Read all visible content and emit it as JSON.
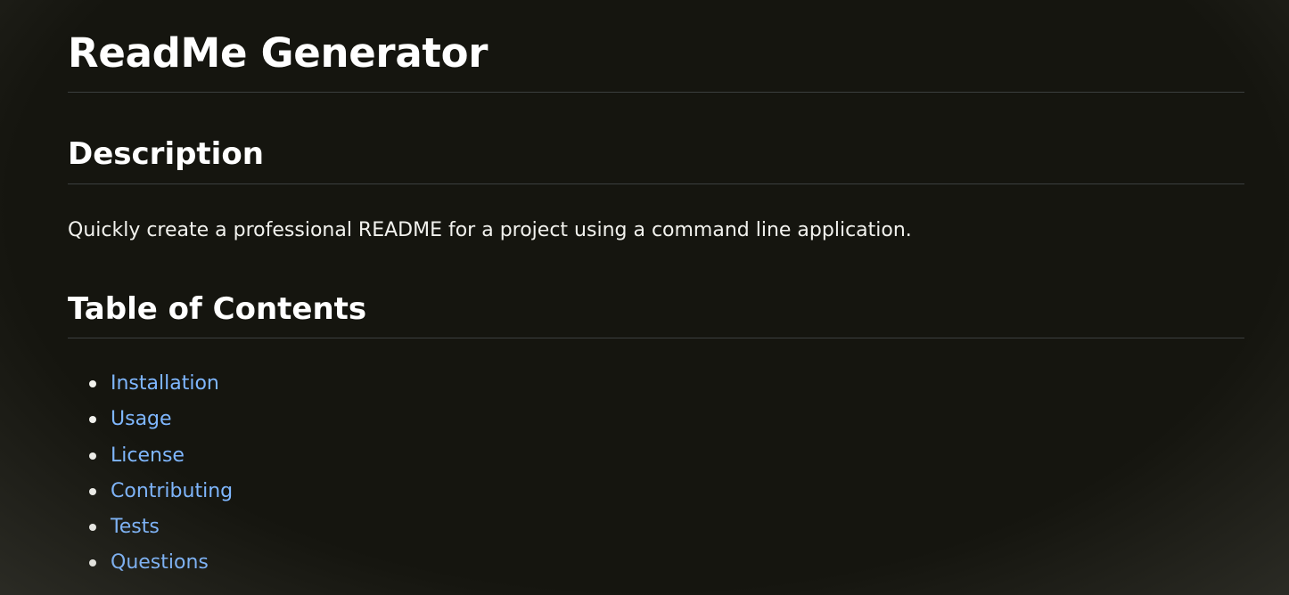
{
  "page": {
    "title": "ReadMe Generator"
  },
  "description": {
    "heading": "Description",
    "text": "Quickly create a professional README for a project using a command line application."
  },
  "toc": {
    "heading": "Table of Contents",
    "items": [
      {
        "label": "Installation"
      },
      {
        "label": "Usage"
      },
      {
        "label": "License"
      },
      {
        "label": "Contributing"
      },
      {
        "label": "Tests"
      },
      {
        "label": "Questions"
      }
    ]
  },
  "colors": {
    "background": "#15150f",
    "text": "#f2f2ee",
    "link": "#7fb7ff",
    "divider": "#3b3f3f"
  }
}
